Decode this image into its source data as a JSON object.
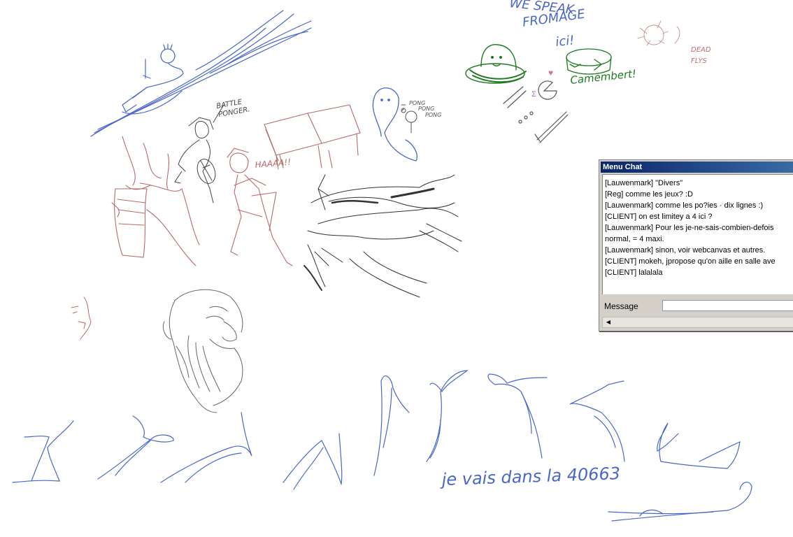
{
  "canvas_texts": {
    "speak_line1": "WE SPEAK",
    "speak_line2": "FROMAGE",
    "speak_line3": "ici!",
    "camembert": "Camembert!",
    "dead_line1": "DEAD",
    "dead_line2": "FLYS",
    "battle_line1": "BATTLE",
    "battle_line2": "PONGER.",
    "haaaa": "HAAAA!!",
    "pong1": "PONG",
    "pong2": "PONG",
    "pong3": "PONG",
    "heart": "♥",
    "signature": "je vais dans la 40663"
  },
  "chat": {
    "title": "Menu Chat",
    "messages": [
      "[Lauwenmark] \"Divers\"",
      "[Reg] comme les jeux? :D",
      "[Lauwenmark] comme les po?ies · dix lignes :)",
      "[CLIENT] on est limitey a 4 ici ?",
      "[Lauwenmark] Pour les je-ne-sais-combien-defois",
      "normal, = 4 maxi.",
      "[Lauwenmark] sinon, voir webcanvas et autres.",
      "[CLIENT] mokeh, jpropose qu'on aille en salle ave",
      "[CLIENT] lalalala"
    ],
    "message_label": "Message",
    "message_value": "",
    "scroll_left_icon": "arrow-left-icon"
  },
  "colors": {
    "blue_ink": "#4a67c8",
    "red_ink": "#b86a6a",
    "green_ink": "#1e7a1e",
    "pencil": "#666666",
    "title_bar": "#0a246a"
  }
}
